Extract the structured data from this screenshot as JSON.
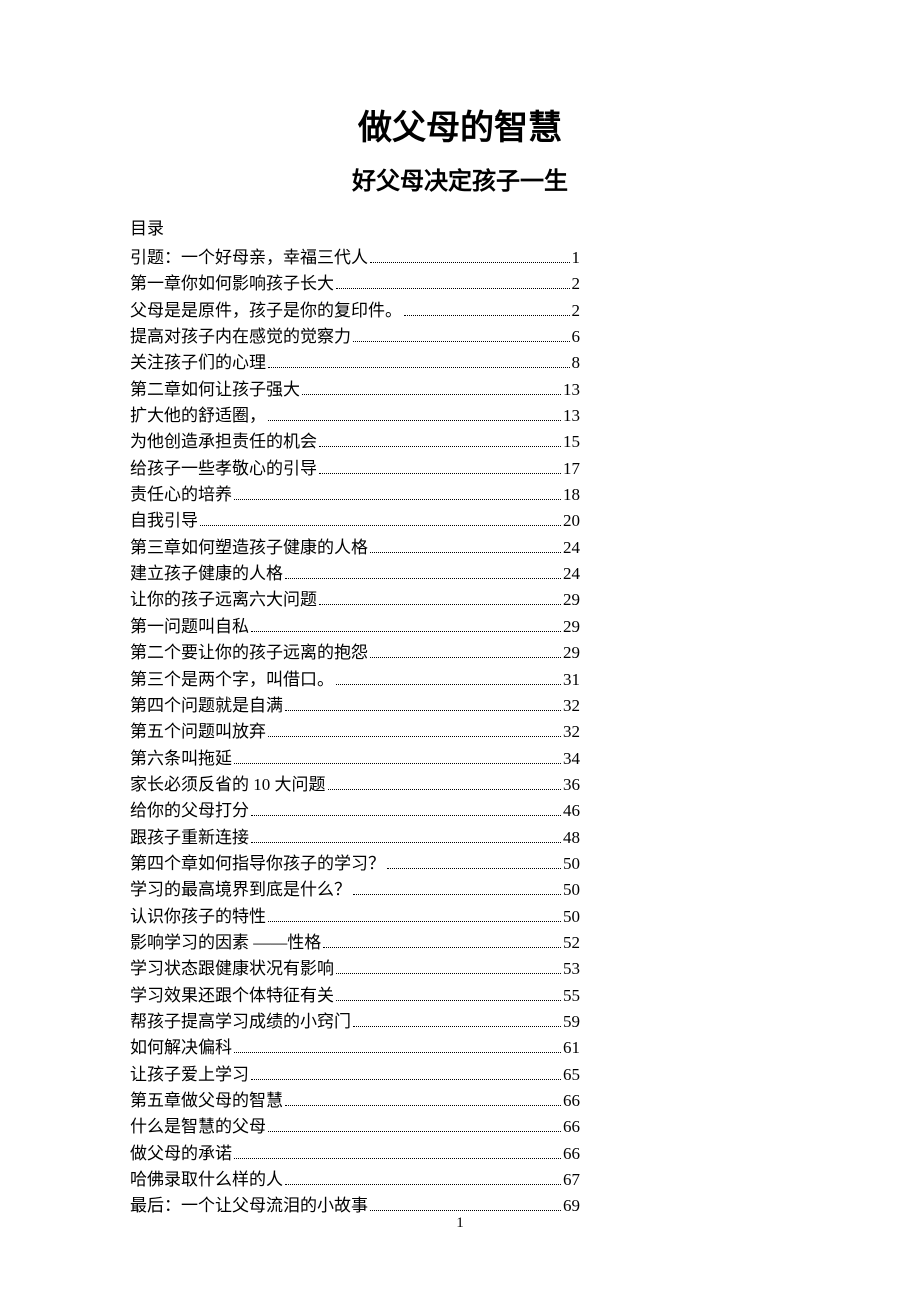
{
  "title": "做父母的智慧",
  "subtitle": "好父母决定孩子一生",
  "toc_label": "目录",
  "page_number": "1",
  "toc": [
    {
      "text": "引题：一个好母亲，幸福三代人",
      "page": "1"
    },
    {
      "text": "第一章你如何影响孩子长大",
      "page": "2"
    },
    {
      "text": "父母是是原件，孩子是你的复印件。 ",
      "page": "2"
    },
    {
      "text": "提高对孩子内在感觉的觉察力",
      "page": "6"
    },
    {
      "text": "关注孩子们的心理 ",
      "page": "8"
    },
    {
      "text": "第二章如何让孩子强大",
      "page": "13"
    },
    {
      "text": "扩大他的舒适圈， ",
      "page": "13"
    },
    {
      "text": "为他创造承担责任的机会 ",
      "page": "15"
    },
    {
      "text": "给孩子一些孝敬心的引导",
      "page": "17"
    },
    {
      "text": "责任心的培养 ",
      "page": " 18"
    },
    {
      "text": "自我引导 ",
      "page": "20"
    },
    {
      "text": "第三章如何塑造孩子健康的人格",
      "page": "24"
    },
    {
      "text": "建立孩子健康的人格 ",
      "page": "24"
    },
    {
      "text": "让你的孩子远离六大问题 ",
      "page": "29"
    },
    {
      "text": "第一问题叫自私",
      "page": "29"
    },
    {
      "text": "第二个要让你的孩子远离的抱怨",
      "page": "29"
    },
    {
      "text": "第三个是两个字，叫借口。 ",
      "page": "31"
    },
    {
      "text": "第四个问题就是自满",
      "page": "32"
    },
    {
      "text": "第五个问题叫放弃 ",
      "page": "32"
    },
    {
      "text": "第六条叫拖延 ",
      "page": "34"
    },
    {
      "text": "家长必须反省的 10 大问题",
      "page": "36"
    },
    {
      "text": "给你的父母打分 ",
      "page": "46"
    },
    {
      "text": "跟孩子重新连接 ",
      "page": "48"
    },
    {
      "text": "第四个章如何指导你孩子的学习？ ",
      "page": "50"
    },
    {
      "text": "学习的最高境界到底是什么？ ",
      "page": "50"
    },
    {
      "text": "认识你孩子的特性 ",
      "page": "50"
    },
    {
      "text": "影响学习的因素 ——性格",
      "page": "52"
    },
    {
      "text": "学习状态跟健康状况有影响 ",
      "page": "53"
    },
    {
      "text": "学习效果还跟个体特征有关 ",
      "page": "55"
    },
    {
      "text": "帮孩子提高学习成绩的小窍门",
      "page": "59"
    },
    {
      "text": "如何解决偏科 ",
      "page": "61"
    },
    {
      "text": "让孩子爱上学习 ",
      "page": "65"
    },
    {
      "text": "第五章做父母的智慧",
      "page": "66"
    },
    {
      "text": "什么是智慧的父母 ",
      "page": "66"
    },
    {
      "text": "做父母的承诺 ",
      "page": "66"
    },
    {
      "text": "哈佛录取什么样的人 ",
      "page": "67"
    },
    {
      "text": "最后：一个让父母流泪的小故事 ",
      "page": "69"
    }
  ]
}
